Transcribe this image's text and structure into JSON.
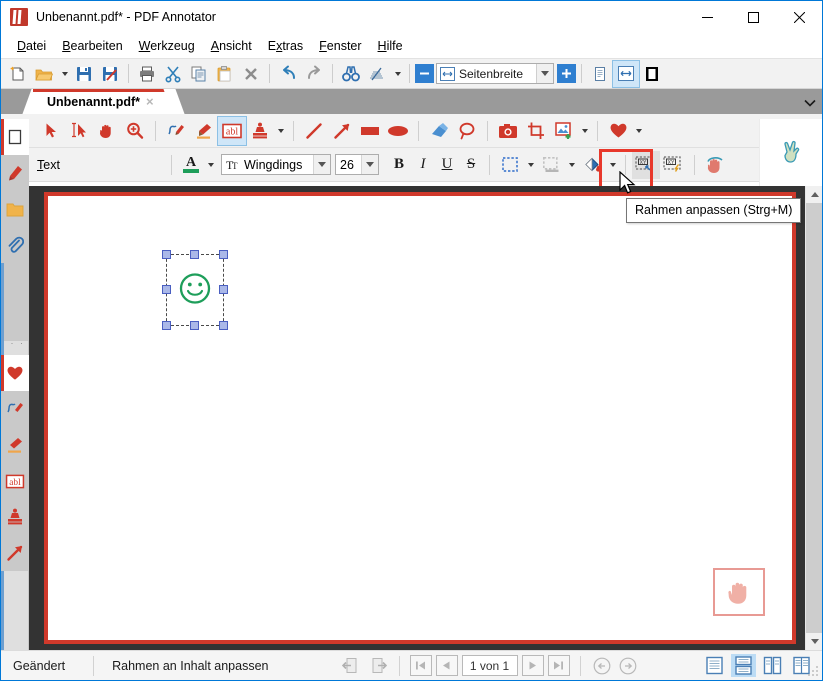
{
  "window": {
    "title": "Unbenannt.pdf* - PDF Annotator",
    "icon": "pdf-annotator-logo",
    "minimize_label": "—",
    "maximize_label": "□",
    "close_label": "✕"
  },
  "menu": {
    "items": [
      {
        "label": "Datei",
        "accel": "D"
      },
      {
        "label": "Bearbeiten",
        "accel": "B"
      },
      {
        "label": "Werkzeug",
        "accel": "W"
      },
      {
        "label": "Ansicht",
        "accel": "A"
      },
      {
        "label": "Extras",
        "accel": "x"
      },
      {
        "label": "Fenster",
        "accel": "F"
      },
      {
        "label": "Hilfe",
        "accel": "H"
      }
    ]
  },
  "main_toolbar": {
    "buttons": [
      {
        "name": "new-document-icon",
        "title": "Neu"
      },
      {
        "name": "open-folder-icon",
        "title": "Öffnen"
      },
      {
        "name": "open-dropdown-icon",
        "title": "Zuletzt geöffnet"
      },
      {
        "name": "save-icon",
        "title": "Speichern"
      },
      {
        "name": "save-as-icon",
        "title": "Speichern unter"
      },
      {
        "name": "print-icon",
        "title": "Drucken"
      },
      {
        "name": "cut-scissors-icon",
        "title": "Ausschneiden"
      },
      {
        "name": "copy-icon",
        "title": "Kopieren"
      },
      {
        "name": "paste-icon",
        "title": "Einfügen"
      },
      {
        "name": "delete-x-icon",
        "title": "Löschen"
      },
      {
        "name": "undo-icon",
        "title": "Rückgängig"
      },
      {
        "name": "redo-icon",
        "title": "Wiederholen"
      },
      {
        "name": "binoculars-search-icon",
        "title": "Suchen"
      },
      {
        "name": "ocr-icon",
        "title": "Texterkennung"
      },
      {
        "name": "ocr-dropdown-icon",
        "title": "Texterkennung Optionen"
      }
    ],
    "zoom_out_label": "–",
    "zoom_value": "Seitenbreite",
    "zoom_in_label": "+",
    "view_single_page": "single-page-view-icon",
    "view_fit_width": "fit-width-view-icon",
    "view_full_screen": "full-screen-view-icon"
  },
  "tabs": {
    "items": [
      {
        "label": "Unbenannt.pdf*",
        "close": "×",
        "active": true
      }
    ],
    "overflow_icon": "chevron-down-icon"
  },
  "annot_toolbar": {
    "buttons": [
      {
        "name": "select-arrow-tool",
        "active": false
      },
      {
        "name": "text-select-tool",
        "active": false
      },
      {
        "name": "hand-pan-tool",
        "active": false
      },
      {
        "name": "zoom-magnifier-tool",
        "active": false
      },
      {
        "name": "pen-tool",
        "active": false
      },
      {
        "name": "highlighter-tool",
        "active": false
      },
      {
        "name": "textbox-tool",
        "active": true
      },
      {
        "name": "stamp-tool",
        "active": false
      },
      {
        "name": "stamp-dropdown",
        "active": false
      },
      {
        "name": "line-tool",
        "active": false
      },
      {
        "name": "arrow-tool",
        "active": false
      },
      {
        "name": "rectangle-tool",
        "active": false
      },
      {
        "name": "ellipse-tool",
        "active": false
      },
      {
        "name": "eraser-tool",
        "active": false
      },
      {
        "name": "lasso-tool",
        "active": false
      },
      {
        "name": "camera-snapshot-tool",
        "active": false
      },
      {
        "name": "crop-tool",
        "active": false
      },
      {
        "name": "insert-image-tool",
        "active": false
      },
      {
        "name": "insert-image-dropdown",
        "active": false
      },
      {
        "name": "favorites-heart-tool",
        "active": false
      },
      {
        "name": "favorites-dropdown",
        "active": false
      }
    ]
  },
  "text_toolbar": {
    "label": "Text",
    "font_color_icon": "font-color-A-icon",
    "font_color": "#1e9e5a",
    "font_name": "Wingdings",
    "font_size": "26",
    "bold_label": "B",
    "italic_label": "I",
    "underline_label": "U",
    "strikethrough_label": "S",
    "border_style_icon": "border-style-icon",
    "shadow_style_icon": "shadow-style-icon",
    "fill-color-icon": "fill-color-icon",
    "fit_frame_icon": "fit-frame-to-content-icon",
    "fit_content_icon": "fit-content-to-frame-icon",
    "touch_mode_icon": "touch-gesture-icon"
  },
  "tooltip": {
    "text": "Rahmen anpassen (Strg+M)"
  },
  "sidebar": {
    "items": [
      {
        "name": "sidebar-pages",
        "icon": "page-thumbnail-icon",
        "selected": true
      },
      {
        "name": "sidebar-bookmarks",
        "icon": "bookmark-icon",
        "selected": false
      },
      {
        "name": "sidebar-folder",
        "icon": "folder-icon",
        "selected": false
      },
      {
        "name": "sidebar-attachments",
        "icon": "paperclip-icon",
        "selected": false
      },
      {
        "name": "sidebar-favorites",
        "icon": "heart-icon",
        "selected": true
      },
      {
        "name": "sidebar-pen",
        "icon": "pen-icon",
        "selected": false
      },
      {
        "name": "sidebar-highlighter",
        "icon": "highlighter-icon",
        "selected": false
      },
      {
        "name": "sidebar-textbox",
        "icon": "textbox-abl-icon",
        "selected": false
      },
      {
        "name": "sidebar-stamp",
        "icon": "stamp-icon",
        "selected": false
      },
      {
        "name": "sidebar-arrow",
        "icon": "arrow-icon",
        "selected": false
      }
    ]
  },
  "document": {
    "page_background": "#ffffff",
    "canvas_background": "#333333",
    "page_border_color": "#d0392b",
    "annotation": {
      "name": "smiley-textbox-annotation",
      "glyph": "☺",
      "color": "#1e9e5a",
      "selected": true,
      "handle_count": 8
    },
    "touch_indicator_icon": "hand-touch-icon"
  },
  "statusbar": {
    "modified_label": "Geändert",
    "hint_label": "Rahmen an Inhalt anpassen",
    "prev_view_icon": "previous-view-icon",
    "next_view_icon": "next-view-icon",
    "first_page_label": "⏮",
    "prev_page_label": "◀",
    "page_indicator": "1 von 1",
    "next_page_label": "▶",
    "last_page_label": "⏭",
    "back_label": "←",
    "forward_label": "→",
    "layout_buttons": [
      {
        "name": "layout-single-page",
        "active": false
      },
      {
        "name": "layout-continuous",
        "active": true
      },
      {
        "name": "layout-two-page",
        "active": false
      },
      {
        "name": "layout-two-page-continuous",
        "active": false
      }
    ]
  },
  "scrollbar": {
    "up_label": "▲",
    "down_label": "▼"
  }
}
